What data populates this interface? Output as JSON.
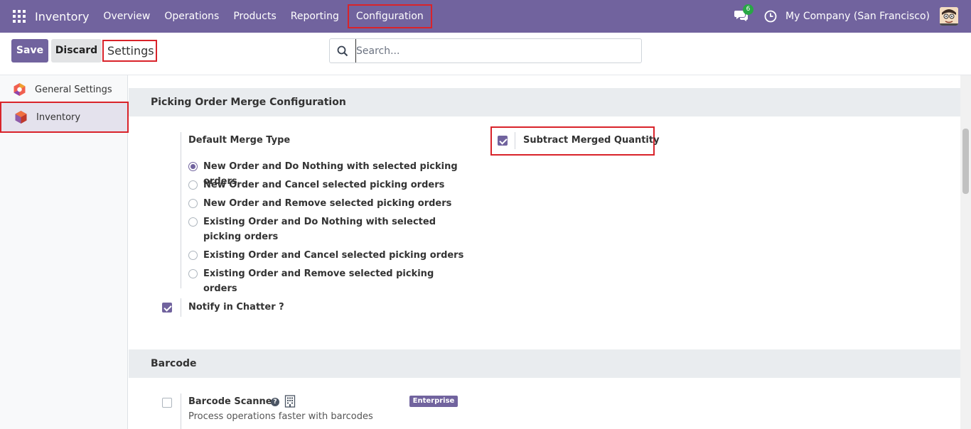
{
  "navbar": {
    "brand": "Inventory",
    "menu": [
      "Overview",
      "Operations",
      "Products",
      "Reporting",
      "Configuration"
    ],
    "chat_badge": "6",
    "company": "My Company (San Francisco)",
    "accent": "#71639e"
  },
  "control": {
    "save_label": "Save",
    "discard_label": "Discard",
    "breadcrumb": "Settings",
    "search_placeholder": "Search..."
  },
  "sidebar": {
    "items": [
      {
        "label": "General Settings",
        "active": false
      },
      {
        "label": "Inventory",
        "active": true
      }
    ]
  },
  "picking": {
    "section_title": "Picking Order Merge Configuration",
    "merge_type_label": "Default Merge Type",
    "options": [
      {
        "label": "New Order and Do Nothing with selected picking orders",
        "checked": true
      },
      {
        "label": "New Order and Cancel selected picking orders",
        "checked": false
      },
      {
        "label": "New Order and Remove selected picking orders",
        "checked": false
      },
      {
        "label": "Existing Order and Do Nothing with selected picking orders",
        "checked": false
      },
      {
        "label": "Existing Order and Cancel selected picking orders",
        "checked": false
      },
      {
        "label": "Existing Order and Remove selected picking orders",
        "checked": false
      }
    ],
    "subtract_label": "Subtract Merged Quantity",
    "subtract_checked": true,
    "notify_label": "Notify in Chatter ?",
    "notify_checked": true
  },
  "barcode": {
    "section_title": "Barcode",
    "scanner_label": "Barcode Scanner",
    "scanner_checked": false,
    "scanner_desc": "Process operations faster with barcodes",
    "enterprise_badge": "Enterprise",
    "help_glyph": "?"
  }
}
